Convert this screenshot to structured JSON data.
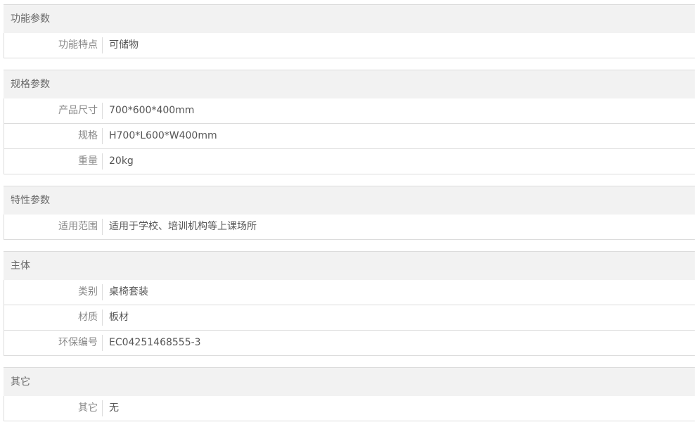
{
  "groups": [
    {
      "title": "功能参数",
      "rows": [
        {
          "label": "功能特点",
          "value": "可储物"
        }
      ]
    },
    {
      "title": "规格参数",
      "rows": [
        {
          "label": "产品尺寸",
          "value": "700*600*400mm"
        },
        {
          "label": "规格",
          "value": "H700*L600*W400mm"
        },
        {
          "label": "重量",
          "value": "20kg"
        }
      ]
    },
    {
      "title": "特性参数",
      "rows": [
        {
          "label": "适用范围",
          "value": "适用于学校、培训机构等上课场所"
        }
      ]
    },
    {
      "title": "主体",
      "rows": [
        {
          "label": "类别",
          "value": "桌椅套装"
        },
        {
          "label": "材质",
          "value": "板材"
        },
        {
          "label": "环保编号",
          "value": "EC04251468555-3"
        }
      ]
    },
    {
      "title": "其它",
      "rows": [
        {
          "label": "其它",
          "value": "无"
        }
      ]
    }
  ]
}
